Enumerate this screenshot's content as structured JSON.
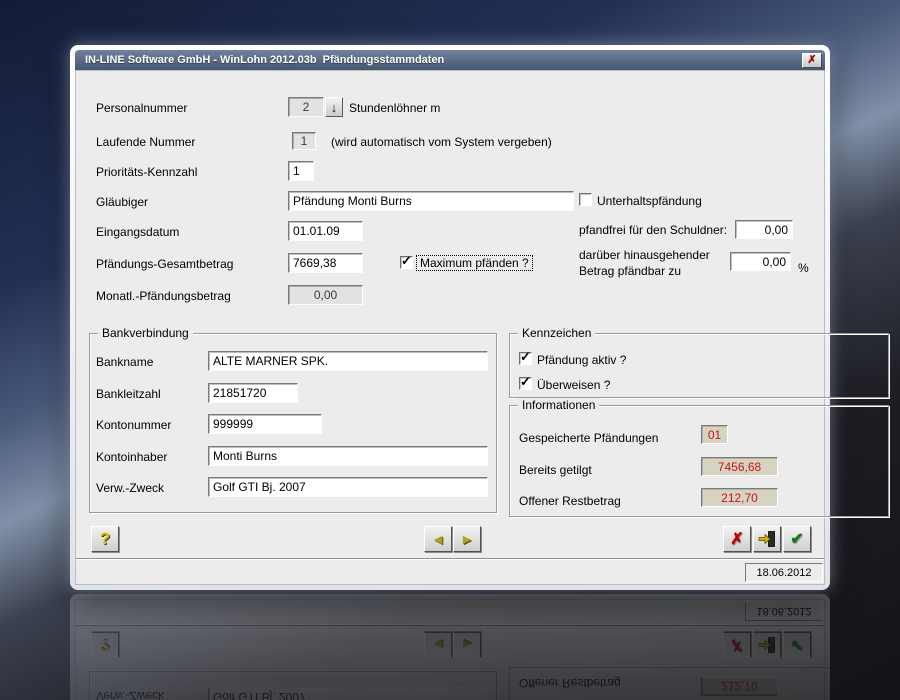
{
  "window": {
    "title": "IN-LINE Software GmbH - WinLohn 2012.03b  Pfändungsstammdaten"
  },
  "icons": {
    "close": "✗",
    "dropdown": "↓",
    "help": "?",
    "prev": "◄",
    "next": "►",
    "cancel": "✗",
    "ok": "✔"
  },
  "form": {
    "personalnummer": {
      "label": "Personalnummer",
      "value": "2",
      "suffix": "Stundenlöhner m"
    },
    "laufende_nummer": {
      "label": "Laufende Nummer",
      "value": "1",
      "note": "(wird automatisch vom System vergeben)"
    },
    "prioritaet": {
      "label": "Prioritäts-Kennzahl",
      "value": "1"
    },
    "glaeubiger": {
      "label": "Gläubiger",
      "value": "Pfändung Monti Burns"
    },
    "unterhaltspfaendung": {
      "label": "Unterhaltspfändung",
      "checked": false
    },
    "eingangsdatum": {
      "label": "Eingangsdatum",
      "value": "01.01.09"
    },
    "pfandfrei": {
      "label": "pfandfrei für den Schuldner:",
      "value": "0,00"
    },
    "gesamtbetrag": {
      "label": "Pfändungs-Gesamtbetrag",
      "value": "7669,38"
    },
    "maximum": {
      "label": "Maximum pfänden ?",
      "checked": true
    },
    "darueber": {
      "line1": "darüber hinausgehender",
      "line2": "Betrag pfändbar zu",
      "value": "0,00",
      "unit": "%"
    },
    "monatl": {
      "label": "Monatl.-Pfändungsbetrag",
      "value": "0,00"
    }
  },
  "bank": {
    "legend": "Bankverbindung",
    "fields": [
      {
        "label": "Bankname",
        "value": "ALTE MARNER SPK."
      },
      {
        "label": "Bankleitzahl",
        "value": "21851720"
      },
      {
        "label": "Kontonummer",
        "value": "999999"
      },
      {
        "label": "Kontoinhaber",
        "value": "Monti Burns"
      },
      {
        "label": "Verw.-Zweck",
        "value": "Golf GTI Bj. 2007"
      }
    ]
  },
  "kennzeichen": {
    "legend": "Kennzeichen",
    "items": [
      {
        "label": "Pfändung aktiv ?",
        "checked": true
      },
      {
        "label": "Überweisen ?",
        "checked": true
      }
    ]
  },
  "info": {
    "legend": "Informationen",
    "items": [
      {
        "label": "Gespeicherte Pfändungen",
        "value": "01"
      },
      {
        "label": "Bereits getilgt",
        "value": "7456,68"
      },
      {
        "label": "Offener Restbetrag",
        "value": "212,70"
      }
    ]
  },
  "statusbar": {
    "date": "18.06.2012"
  },
  "colors": {
    "titlebar": "#53637f",
    "dialog_bg": "#ececec",
    "value_red": "#cc1414",
    "accent_yellow": "#e6c400"
  }
}
